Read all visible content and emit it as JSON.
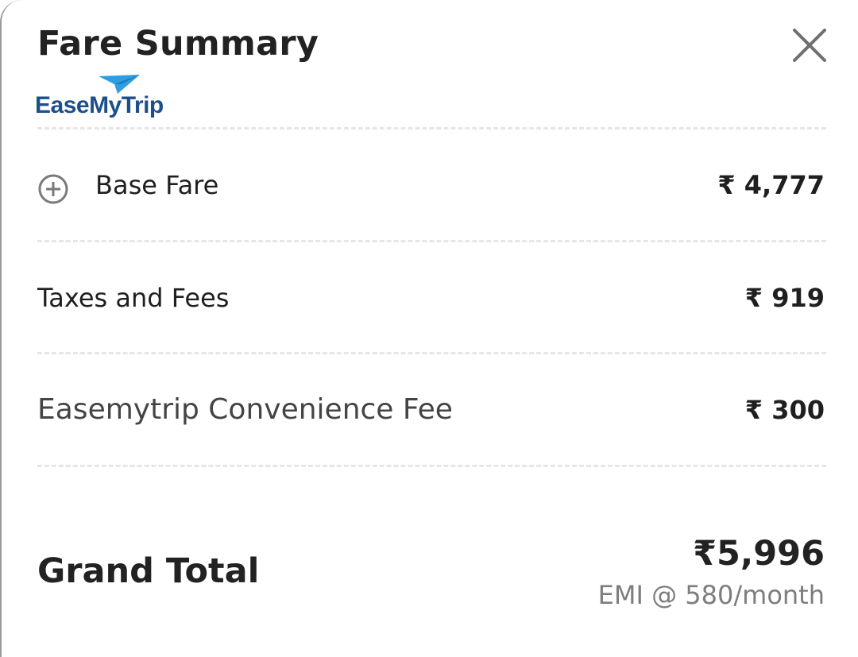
{
  "header": {
    "title": "Fare Summary",
    "close_icon": "close-icon"
  },
  "brand": {
    "name": "EaseMyTrip",
    "logo_icon": "paper-plane-icon",
    "text_color": "#1c4f8c",
    "plane_color": "#2f9ee0"
  },
  "fare": {
    "base_fare": {
      "label": "Base Fare",
      "value": "₹ 4,777",
      "expand_icon": "plus-circle-icon"
    },
    "taxes": {
      "label": "Taxes and Fees",
      "value": "₹ 919"
    },
    "convenience": {
      "label": "Easemytrip Convenience Fee",
      "value": "₹ 300"
    }
  },
  "total": {
    "label": "Grand Total",
    "value": "₹5,996",
    "emi": "EMI @ 580/month"
  }
}
